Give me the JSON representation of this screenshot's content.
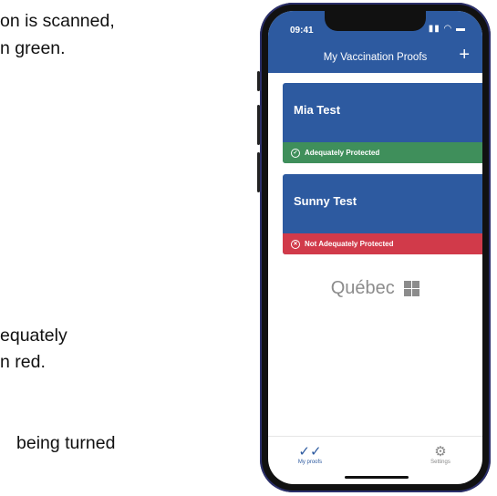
{
  "slide_text": {
    "line1": "on is scanned,",
    "line2": "n green.",
    "line3": "equately",
    "line4": "n red.",
    "line5": "being turned"
  },
  "status_bar": {
    "time": "09:41"
  },
  "app": {
    "title": "My Vaccination Proofs",
    "add_label": "+",
    "cards": [
      {
        "name": "Mia Test",
        "status": "Adequately Protected",
        "status_icon": "check-circle-icon",
        "status_color": "#3f8f5b",
        "card_color": "#2d5aa0"
      },
      {
        "name": "Sunny Test",
        "status": "Not Adequately Protected",
        "status_icon": "x-circle-icon",
        "status_color": "#d13a4a",
        "card_color": "#2d5aa0"
      }
    ],
    "logo_text": "Québec",
    "tabs": [
      {
        "label": "My proofs",
        "icon": "double-check-icon"
      },
      {
        "label": "Settings",
        "icon": "gear-icon"
      }
    ]
  },
  "colors": {
    "green_arrow": "#19a545",
    "red_arrow": "#ee1111",
    "app_blue": "#2d5aa0"
  }
}
